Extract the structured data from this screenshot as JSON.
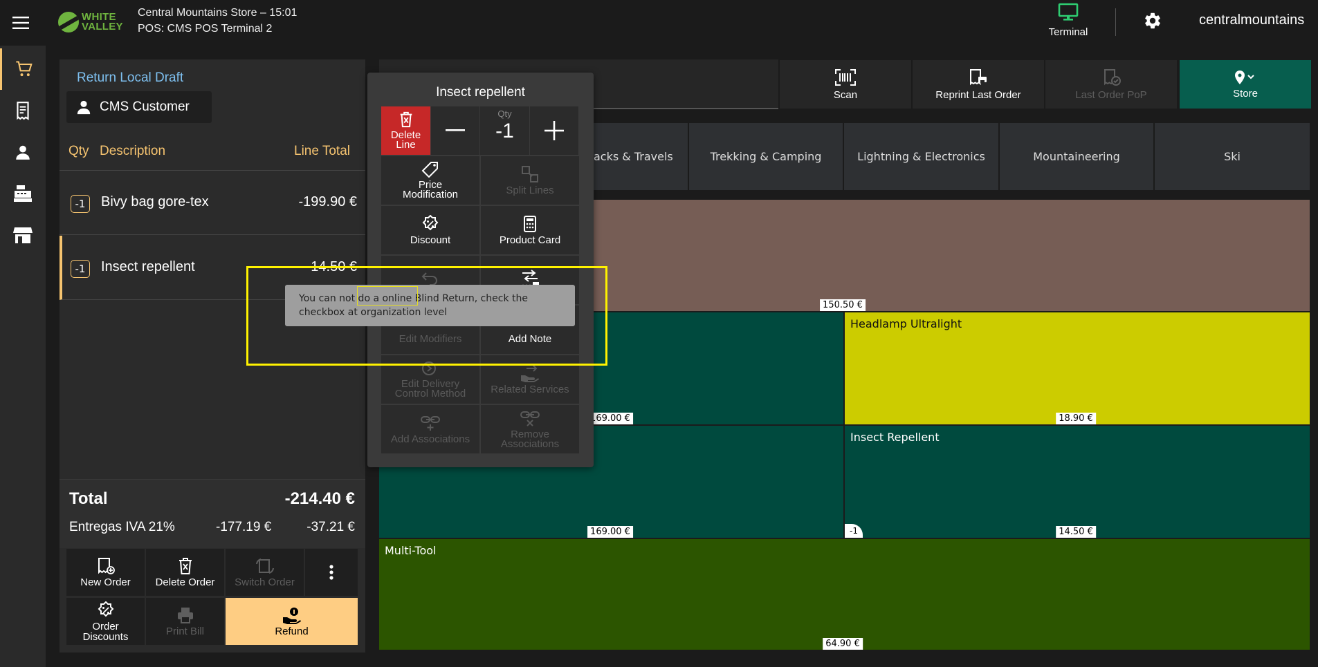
{
  "header": {
    "logo": "WHITE VALLEY",
    "store_line": "Central Mountains Store – 15:01",
    "terminal_line": "POS: CMS POS Terminal 2",
    "terminal_label": "Terminal",
    "user": "centralmountains",
    "colors": {
      "terminal_icon": "#2ecc71",
      "logo": "#6fb43f"
    }
  },
  "nav": {
    "items": [
      {
        "icon": "cart-icon"
      },
      {
        "icon": "receipt-icon"
      },
      {
        "icon": "person-icon"
      },
      {
        "icon": "cash-register-icon"
      },
      {
        "icon": "store-icon"
      }
    ]
  },
  "ticket": {
    "title": "Return Local Draft",
    "customer": "CMS Customer",
    "columns": {
      "qty": "Qty",
      "description": "Description",
      "line_total": "Line Total"
    },
    "lines": [
      {
        "qty": "-1",
        "description": "Bivy bag gore-tex",
        "total": "-199.90 €"
      },
      {
        "qty": "-1",
        "description": "Insect repellent",
        "total": "-14.50 €"
      }
    ],
    "total_label": "Total",
    "total_value": "-214.40 €",
    "tax": {
      "label": "Entregas IVA 21%",
      "base": "-177.19 €",
      "amount": "-37.21 €"
    },
    "buttons": {
      "new_order": "New Order",
      "delete_order": "Delete Order",
      "switch_order": "Switch Order",
      "order_discounts": "Order Discounts",
      "print_bill": "Print Bill",
      "refund": "Refund"
    }
  },
  "toolbar": {
    "scan": "Scan",
    "reprint": "Reprint Last Order",
    "last_pop": "Last Order PoP",
    "store": "Store"
  },
  "categories": [
    "acks & Travels",
    "Trekking & Camping",
    "Lightning & Electronics",
    "Mountaineering",
    "Ski"
  ],
  "tiles": [
    {
      "name": "",
      "price": "150.50 €",
      "qty": ""
    },
    {
      "name": "",
      "price": "169.00 €",
      "qty": ""
    },
    {
      "name": "Headlamp Ultralight",
      "price": "18.90 €",
      "qty": ""
    },
    {
      "name": "",
      "price": "169.00 €",
      "qty": ""
    },
    {
      "name": "Insect Repellent",
      "price": "14.50 €",
      "qty": "-1"
    },
    {
      "name": "Multi-Tool",
      "price": "64.90 €",
      "qty": ""
    }
  ],
  "popup": {
    "title": "Insect repellent",
    "delete_line": "Delete Line",
    "qty_label": "Qty",
    "qty_value": "-1",
    "price_modification": "Price Modification",
    "split_lines": "Split Lines",
    "discount": "Discount",
    "product_card": "Product Card",
    "edit_modifiers": "Edit Modifiers",
    "add_note": "Add Note",
    "edit_delivery": "Edit Delivery Control Method",
    "related_services": "Related Services",
    "add_associations": "Add Associations",
    "remove_associations": "Remove Associations"
  },
  "tooltip": {
    "text": "You can not do a online Blind Return, check the checkbox at organization level"
  }
}
